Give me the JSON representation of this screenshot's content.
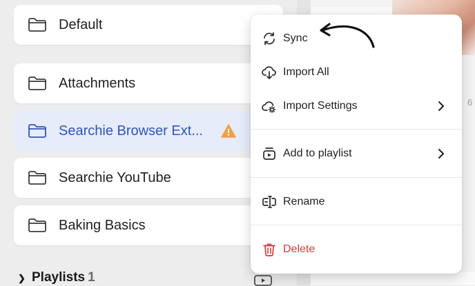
{
  "folders": [
    {
      "label": "Default",
      "icon": "folder-icon",
      "active": false
    },
    {
      "label": "Attachments",
      "icon": "folder-icon",
      "active": false
    },
    {
      "label": "Searchie Browser Ext...",
      "icon": "folder-icon",
      "active": true,
      "badge": "warning-icon"
    },
    {
      "label": "Searchie YouTube",
      "icon": "folder-icon",
      "active": false
    },
    {
      "label": "Baking Basics",
      "icon": "folder-icon",
      "active": false
    }
  ],
  "playlists": {
    "label": "Playlists",
    "count": "1"
  },
  "context_menu": {
    "sync": {
      "label": "Sync",
      "icon": "sync-icon"
    },
    "import_all": {
      "label": "Import All",
      "icon": "cloud-download-icon"
    },
    "import_settings": {
      "label": "Import Settings",
      "icon": "cloud-settings-icon",
      "has_submenu": true
    },
    "add_to_playlist": {
      "label": "Add to playlist",
      "icon": "playlist-add-icon",
      "has_submenu": true
    },
    "rename": {
      "label": "Rename",
      "icon": "rename-icon"
    },
    "delete": {
      "label": "Delete",
      "icon": "trash-icon"
    }
  },
  "content_fragment": {
    "digit": "6"
  },
  "colors": {
    "accent_blue": "#2f55b8",
    "active_row_bg": "#e6ecf9",
    "danger_red": "#d83838",
    "warning_orange": "#f0a04b"
  }
}
